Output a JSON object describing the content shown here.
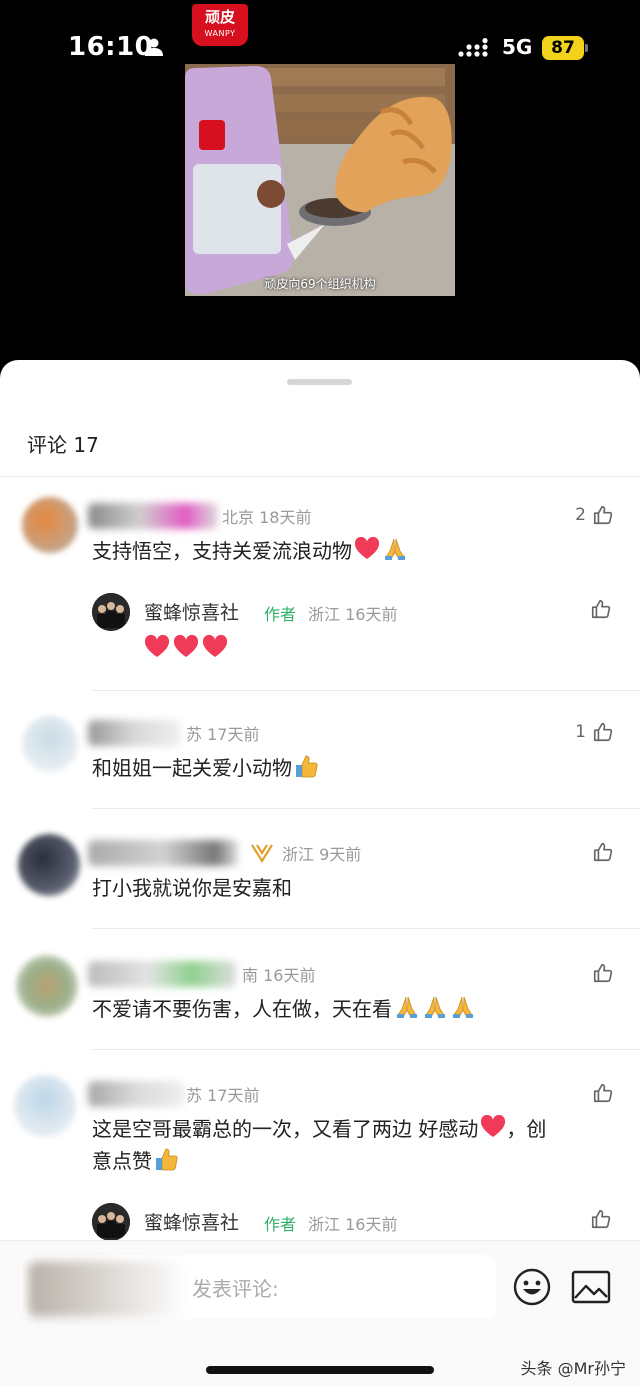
{
  "status_bar": {
    "time": "16:10",
    "network": "5G",
    "battery": "87",
    "icons": [
      "person-icon",
      "signal-icon"
    ]
  },
  "brand": {
    "name_cn": "顽皮",
    "name_en": "WANPY"
  },
  "video": {
    "caption": "顽皮向69个组织机构"
  },
  "comments_header": {
    "title": "评论 17"
  },
  "comments": [
    {
      "location_time": "北京 18天前",
      "text": "支持悟空，支持关爱流浪动物",
      "emoji": [
        "heart",
        "pray"
      ],
      "likes": "2",
      "reply": {
        "name": "蜜蜂惊喜社",
        "tag": "作者",
        "location_time": "浙江 16天前",
        "emoji": [
          "heart",
          "heart",
          "heart"
        ]
      }
    },
    {
      "location_time": "苏 17天前",
      "text": "和姐姐一起关爱小动物",
      "emoji": [
        "thumbs-up"
      ],
      "likes": "1"
    },
    {
      "location_time": "浙江 9天前",
      "text": "打小我就说你是安嘉和",
      "emoji": [],
      "likes": ""
    },
    {
      "location_time": "南 16天前",
      "text": "不爱请不要伤害，人在做，天在看",
      "emoji": [
        "pray",
        "pray",
        "pray"
      ],
      "likes": ""
    },
    {
      "location_time": "苏 17天前",
      "text": "这是空哥最霸总的一次，又看了两边 好感动",
      "text_line2": "意点赞",
      "likes": "",
      "reply": {
        "name": "蜜蜂惊喜社",
        "tag": "作者",
        "location_time": "浙江 16天前"
      }
    }
  ],
  "input": {
    "placeholder": "发表评论:"
  },
  "watermark": "头条 @Mr孙宁",
  "colors": {
    "author_tag": "#2fb066",
    "battery": "#f2d21a",
    "brand": "#d6101e",
    "heart": "#ef3b58"
  }
}
